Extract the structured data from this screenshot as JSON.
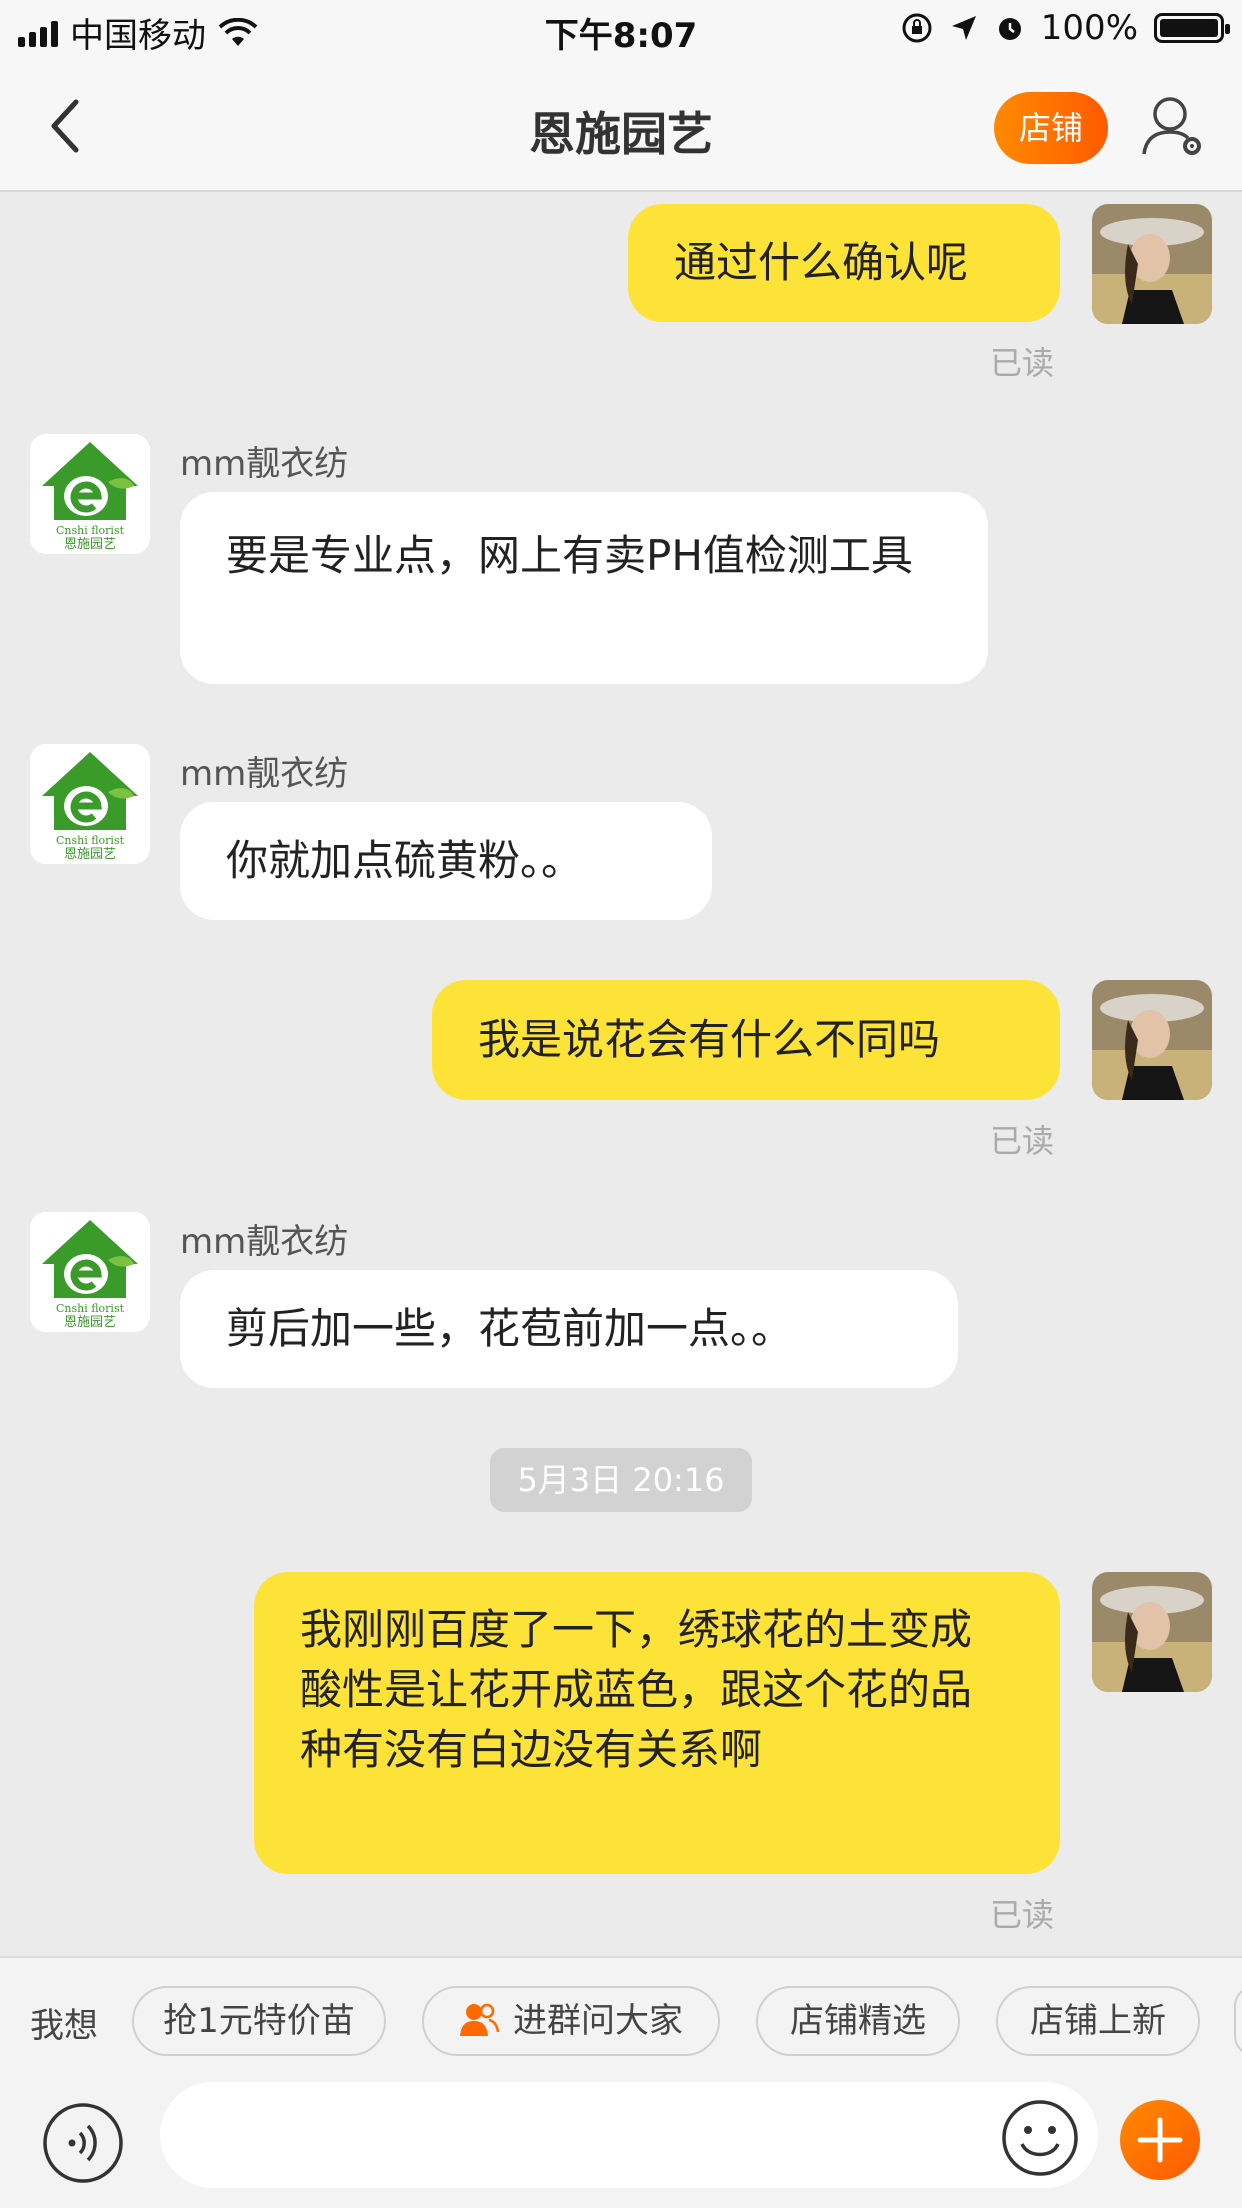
{
  "status": {
    "carrier": "中国移动",
    "time": "下午8:07",
    "battery": "100%"
  },
  "nav": {
    "title": "恩施园艺",
    "shop_label": "店铺"
  },
  "messages": [
    {
      "side": "right",
      "text": "通过什么确认呢",
      "status": "已读"
    },
    {
      "side": "left",
      "sender": "mm靓衣纺",
      "text": "要是专业点，网上有卖PH值检测工具"
    },
    {
      "side": "left",
      "sender": "mm靓衣纺",
      "text": "你就加点硫黄粉。。"
    },
    {
      "side": "right",
      "text": "我是说花会有什么不同吗",
      "status": "已读"
    },
    {
      "side": "left",
      "sender": "mm靓衣纺",
      "text": "剪后加一些，花苞前加一点。。"
    },
    {
      "timestamp": "5月3日 20:16"
    },
    {
      "side": "right",
      "text": "我刚刚百度了一下，绣球花的土变成酸性是让花开成蓝色，跟这个花的品种有没有白边没有关系啊",
      "status": "已读"
    }
  ],
  "logo_text": {
    "brand": "Cnshi florist",
    "name": "恩施园艺"
  },
  "quick": {
    "label": "我想",
    "chips": [
      "抢1元特价苗",
      "进群问大家",
      "店铺精选",
      "店铺上新"
    ]
  },
  "input": {
    "placeholder": ""
  },
  "colors": {
    "accent": "#ff7a00",
    "bubble_self": "#fde338",
    "bubble_other": "#ffffff",
    "background": "#ebebeb"
  }
}
